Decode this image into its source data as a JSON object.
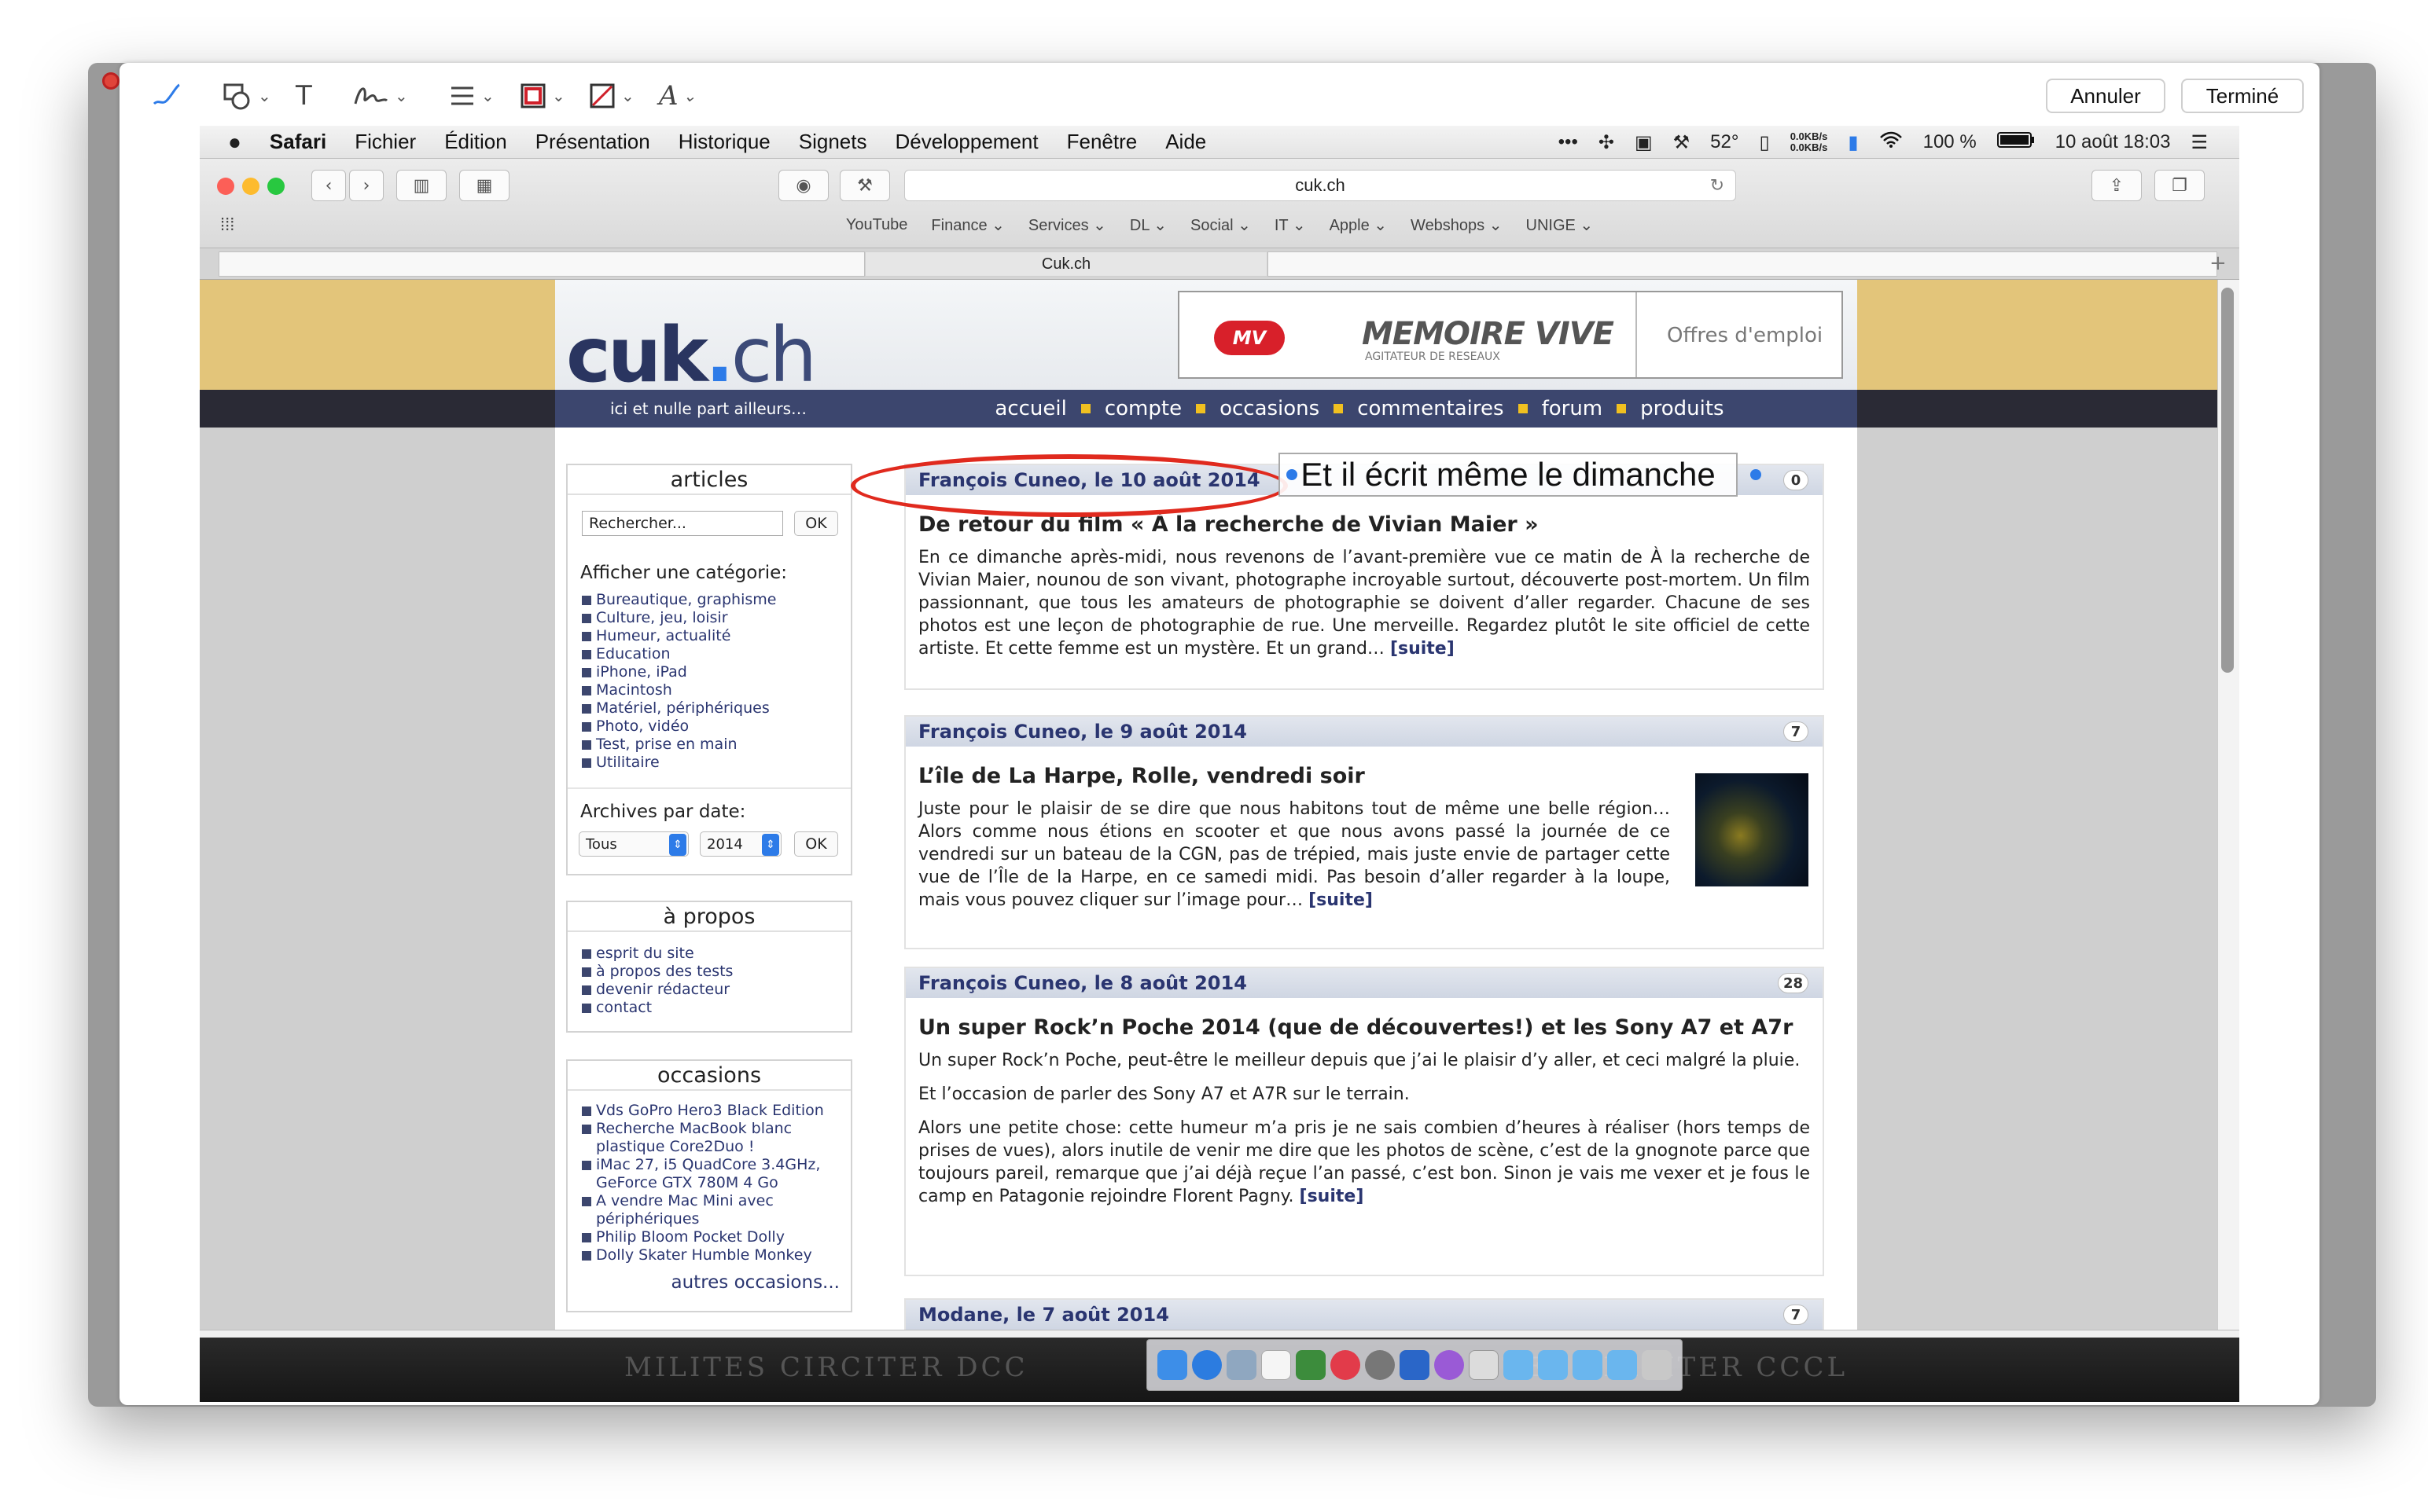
{
  "markup_toolbar": {
    "tools": [
      "sketch-icon",
      "shapes-icon",
      "text-icon",
      "signature-icon",
      "line-style-icon",
      "border-color-icon",
      "fill-color-icon",
      "font-icon"
    ],
    "text_tool": "T",
    "cancel_label": "Annuler",
    "done_label": "Terminé"
  },
  "menubar": {
    "apple": "",
    "app": "Safari",
    "items": [
      "Fichier",
      "Édition",
      "Présentation",
      "Historique",
      "Signets",
      "Développement",
      "Fenêtre",
      "Aide"
    ],
    "temperature": "52°",
    "net_up": "0.0KB/s",
    "net_down": "0.0KB/s",
    "battery": "100 %",
    "datetime": "10 août 18:03"
  },
  "browser": {
    "url": "cuk.ch",
    "favorites": [
      "YouTube",
      "Finance ⌄",
      "Services ⌄",
      "DL ⌄",
      "Social ⌄",
      "IT ⌄",
      "Apple ⌄",
      "Webshops ⌄",
      "UNIGE ⌄"
    ],
    "tab_title": "Cuk.ch"
  },
  "site": {
    "logo_main": "cuk",
    "logo_dot": ".",
    "logo_tld": "ch",
    "tagline": "ici et nulle part ailleurs…",
    "nav": [
      "accueil",
      "compte",
      "occasions",
      "commentaires",
      "forum",
      "produits"
    ],
    "ad": {
      "logo": "MV",
      "title": "MEMOIRE VIVE",
      "subtitle": "AGITATEUR DE RESEAUX",
      "jobs": "Offres d'emploi"
    }
  },
  "sidebar": {
    "articles": {
      "title": "articles",
      "search_placeholder": "Rechercher...",
      "ok": "OK",
      "cat_label": "Afficher une catégorie:",
      "categories": [
        "Bureautique, graphisme",
        "Culture, jeu, loisir",
        "Humeur, actualité",
        "Education",
        "iPhone, iPad",
        "Macintosh",
        "Matériel, périphériques",
        "Photo, vidéo",
        "Test, prise en main",
        "Utilitaire"
      ],
      "archive_label": "Archives par date:",
      "archive_all": "Tous",
      "archive_year": "2014",
      "archive_ok": "OK"
    },
    "apropos": {
      "title": "à propos",
      "items": [
        "esprit du site",
        "à propos des tests",
        "devenir rédacteur",
        "contact"
      ]
    },
    "occasions": {
      "title": "occasions",
      "items": [
        "Vds GoPro Hero3 Black Edition",
        "Recherche MacBook blanc plastique Core2Duo !",
        "iMac 27, i5 QuadCore 3.4GHz, GeForce GTX 780M 4 Go",
        "A vendre Mac Mini avec périphériques",
        "Philip Bloom Pocket Dolly",
        "Dolly Skater Humble Monkey"
      ],
      "more": "autres occasions..."
    }
  },
  "posts": [
    {
      "header": "François Cuneo, le 10 août 2014",
      "count": "0",
      "title": "De retour du film « À la recherche de Vivian Maier »",
      "paragraphs": [
        "En ce dimanche après-midi, nous revenons de l’avant-première vue ce matin de À la recherche de Vivian Maier, nounou de son vivant, photographe incroyable surtout, découverte post-mortem. Un film passionnant, que tous les amateurs de photographie se doivent d’aller regarder.   Chacune de ses photos est une leçon de photographie de rue. Une merveille. Regardez plutôt le site officiel de cette artiste. Et cette femme est un mystère. Et un grand…"
      ],
      "suite": "[suite]"
    },
    {
      "header": "François Cuneo, le 9 août 2014",
      "count": "7",
      "title": "L’île de La Harpe, Rolle, vendredi soir",
      "paragraphs": [
        "Juste pour le plaisir de se dire que nous habitons tout de même une belle région… Alors comme nous étions en scooter et que nous avons passé la journée de ce vendredi sur un bateau de la CGN, pas de trépied, mais juste envie de partager cette vue de l’Île de la Harpe, en ce samedi midi. Pas besoin d’aller regarder à la loupe, mais vous pouvez cliquer sur l’image pour…"
      ],
      "suite": "[suite]"
    },
    {
      "header": "François Cuneo, le 8 août 2014",
      "count": "28",
      "title": "Un super Rock’n Poche 2014 (que de découvertes!) et les Sony A7 et A7r",
      "paragraphs": [
        "Un super Rock’n Poche, peut-être le meilleur depuis que j’ai le plaisir d’y aller, et ceci malgré la pluie.",
        "Et l’occasion de parler des Sony A7 et A7R sur le terrain.",
        "Alors une petite chose: cette humeur m’a pris je ne sais combien d’heures à réaliser (hors temps de prises de vues), alors inutile de venir me dire que les photos de scène, c’est de la gnognote parce que toujours pareil, remarque que j’ai déjà reçue l’an passé, c’est bon. Sinon je vais me vexer et je fous le camp en Patagonie rejoindre Florent Pagny."
      ],
      "suite": "[suite]"
    },
    {
      "header": "Modane, le 7 août 2014",
      "count": "7"
    }
  ],
  "annotation": {
    "text": "Et il écrit même le dimanche"
  },
  "dock": {
    "left_carving": "MILITES CIRCITER DCC",
    "right_carving": "ITES CIRCITER CCCL"
  },
  "colors": {
    "accent_red": "#e02a1e",
    "nav_blue": "#3c466e",
    "gold": "#e3c57a",
    "link": "#2a3570"
  }
}
